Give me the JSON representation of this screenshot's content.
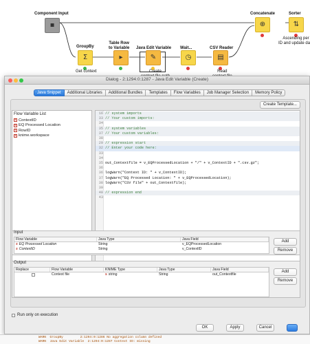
{
  "workflow": {
    "nodes": [
      {
        "id": "component-input",
        "title": "Component Input",
        "sub": "",
        "color": "grey",
        "glyph": "▪"
      },
      {
        "id": "groupby",
        "title": "GroupBy",
        "sub": "Get context",
        "color": "yellow",
        "glyph": "Σ"
      },
      {
        "id": "table-row-to-variable",
        "title": "Table Row\nto Variable",
        "sub": "",
        "color": "orange",
        "glyph": "▸"
      },
      {
        "id": "java-edit-variable",
        "title": "Java Edit Variable",
        "sub": "Create\ncontext file path",
        "color": "orange",
        "glyph": "✎"
      },
      {
        "id": "wait",
        "title": "Wait...",
        "sub": "",
        "color": "yellow",
        "glyph": "◷"
      },
      {
        "id": "csv-reader",
        "title": "CSV Reader",
        "sub": "Read\ncontext file",
        "color": "orange",
        "glyph": "▤"
      },
      {
        "id": "concatenate",
        "title": "Concatenate",
        "sub": "",
        "color": "yellow",
        "glyph": "⊕"
      },
      {
        "id": "sorter",
        "title": "Sorter",
        "sub": "Ascending per\nID and update date",
        "color": "yellow",
        "glyph": "⇅"
      }
    ]
  },
  "dialog": {
    "title": "Dialog - 2:1294:0:1287 - Java Edit Variable (Create)",
    "tabs": [
      "Java Snippet",
      "Additional Libraries",
      "Additional Bundles",
      "Templates",
      "Flow Variables",
      "Job Manager Selection",
      "Memory Policy"
    ],
    "active_tab": "Java Snippet",
    "create_template_label": "Create Template...",
    "flow_variable_list": {
      "title": "Flow Variable List",
      "items": [
        "ContextID",
        "EQ Processed Location",
        "RowID",
        "knime.workspace"
      ]
    },
    "code": [
      {
        "n": "16",
        "text": "// system imports",
        "kind": "comment",
        "shade": true
      },
      {
        "n": "33",
        "text": "// Your custom imports:",
        "kind": "comment",
        "shade": true
      },
      {
        "n": "34",
        "text": "",
        "kind": "code",
        "shade": false
      },
      {
        "n": "35",
        "text": "// system variables",
        "kind": "comment",
        "shade": true
      },
      {
        "n": "37",
        "text": "// Your custom variables:",
        "kind": "comment",
        "shade": true
      },
      {
        "n": "38",
        "text": "",
        "kind": "code",
        "shade": false
      },
      {
        "n": "29",
        "text": "// expression start",
        "kind": "comment",
        "shade": true
      },
      {
        "n": "32",
        "text": "// Enter your code here:",
        "kind": "comment",
        "shade": true,
        "caret": true
      },
      {
        "n": "33",
        "text": "",
        "kind": "code",
        "shade": false
      },
      {
        "n": "34",
        "text": "",
        "kind": "code",
        "shade": false
      },
      {
        "n": "35",
        "text": "out_Contextfile = v_EQProcessedLocation + \"/\" + v_ContextID + \".csv.gz\";",
        "kind": "code",
        "shade": false
      },
      {
        "n": "36",
        "text": "",
        "kind": "code",
        "shade": false
      },
      {
        "n": "36",
        "text": "logWarn(\"Context ID: \" + v_ContextID);",
        "kind": "code",
        "shade": false
      },
      {
        "n": "37",
        "text": "logWarn(\"EQ Processed Location: \" + v_EQProcessedLocation);",
        "kind": "code",
        "shade": false
      },
      {
        "n": "38",
        "text": "logWarn(\"CSV file\" + out_Contextfile);",
        "kind": "code",
        "shade": false
      },
      {
        "n": "39",
        "text": "",
        "kind": "code",
        "shade": false
      },
      {
        "n": "40",
        "text": "// expression end",
        "kind": "comment",
        "shade": true
      },
      {
        "n": "43",
        "text": "",
        "kind": "code",
        "shade": false
      }
    ],
    "input": {
      "label": "Input",
      "headers": [
        "Flow Variable",
        "Java Type",
        "Java Field"
      ],
      "rows": [
        [
          "EQ Processed Location",
          "String",
          "v_EQProcessedLocation"
        ],
        [
          "ContextID",
          "String",
          "v_ContextID"
        ]
      ],
      "add_label": "Add",
      "remove_label": "Remove"
    },
    "output": {
      "label": "Output",
      "headers": [
        "Replace",
        "Flow Variable",
        "KNIME Type",
        "Java Type",
        "Java Field"
      ],
      "rows": [
        [
          "",
          "Context file",
          "string",
          "String",
          "out_Contextfile"
        ]
      ],
      "add_label": "Add",
      "remove_label": "Remove"
    },
    "run_only_on_execution_label": "Run only on execution",
    "ok_label": "OK",
    "apply_label": "Apply",
    "cancel_label": "Cancel"
  },
  "log": [
    "WARN  GroupBy         2:1294:0:1286 No aggregation column defined",
    "WARN  Java Edit Variable  2:1294:0:1287 Context ID: missing"
  ]
}
